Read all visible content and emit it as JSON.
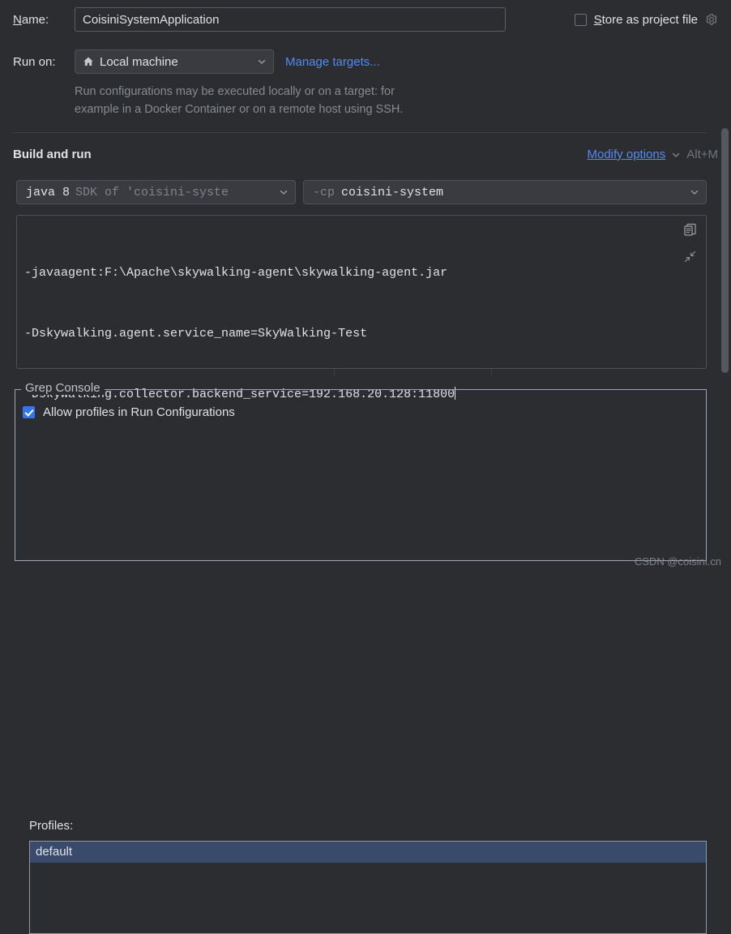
{
  "theme": {
    "bg": "#2b2d30",
    "field_bg": "#393b40",
    "border": "#4e5157",
    "text": "#dfe1e5",
    "muted": "#868a91",
    "link": "#548af7",
    "accent": "#3574f0",
    "selection_bg": "#3a4a6b",
    "group_border": "#9aa7b8"
  },
  "name_row": {
    "label_prefix": "N",
    "label_rest": "ame:",
    "value": "CoisiniSystemApplication",
    "placeholder": "Name"
  },
  "store_as_project_file": {
    "checked": false,
    "label_prefix": "S",
    "label_rest": "tore as project file",
    "gear_icon": "gear-icon"
  },
  "run_on": {
    "label": "Run on:",
    "icon": "home-icon",
    "value": "Local machine",
    "manage_link": "Manage targets...",
    "chevron": "chevron-down-icon"
  },
  "hint": {
    "line1": "Run configurations may be executed locally or on a target: for",
    "line2": "example in a Docker Container or on a remote host using SSH."
  },
  "build_and_run": {
    "title": "Build and run",
    "modify_options": "Modify options",
    "modify_options_prefix": "M",
    "modify_options_rest": "odify options",
    "shortcut": "Alt+M",
    "chevron": "chevron-down-icon"
  },
  "sdk_combo": {
    "main": "java 8",
    "sub": "SDK of 'coisini-syste",
    "chevron": "chevron-down-icon"
  },
  "classpath_combo": {
    "flag": "-cp",
    "value": "coisini-system",
    "chevron": "chevron-down-icon"
  },
  "vm_options": {
    "lines": [
      "-javaagent:F:\\Apache\\skywalking-agent\\skywalking-agent.jar",
      "-Dskywalking.agent.service_name=SkyWalking-Test",
      "-Dskywalking.collector.backend_service=192.168.20.128:11800"
    ],
    "copy_icon": "copy-icon",
    "expand_icon": "collapse-arrows-icon",
    "caret_visible": true
  },
  "grep_console": {
    "legend": "Grep Console",
    "allow_profiles": {
      "checked": true,
      "label": "Allow profiles in Run Configurations"
    },
    "profiles_label": "Profiles:",
    "profiles": [
      {
        "label": "default",
        "selected": true
      }
    ]
  },
  "watermark": "CSDN @coisini.cn"
}
